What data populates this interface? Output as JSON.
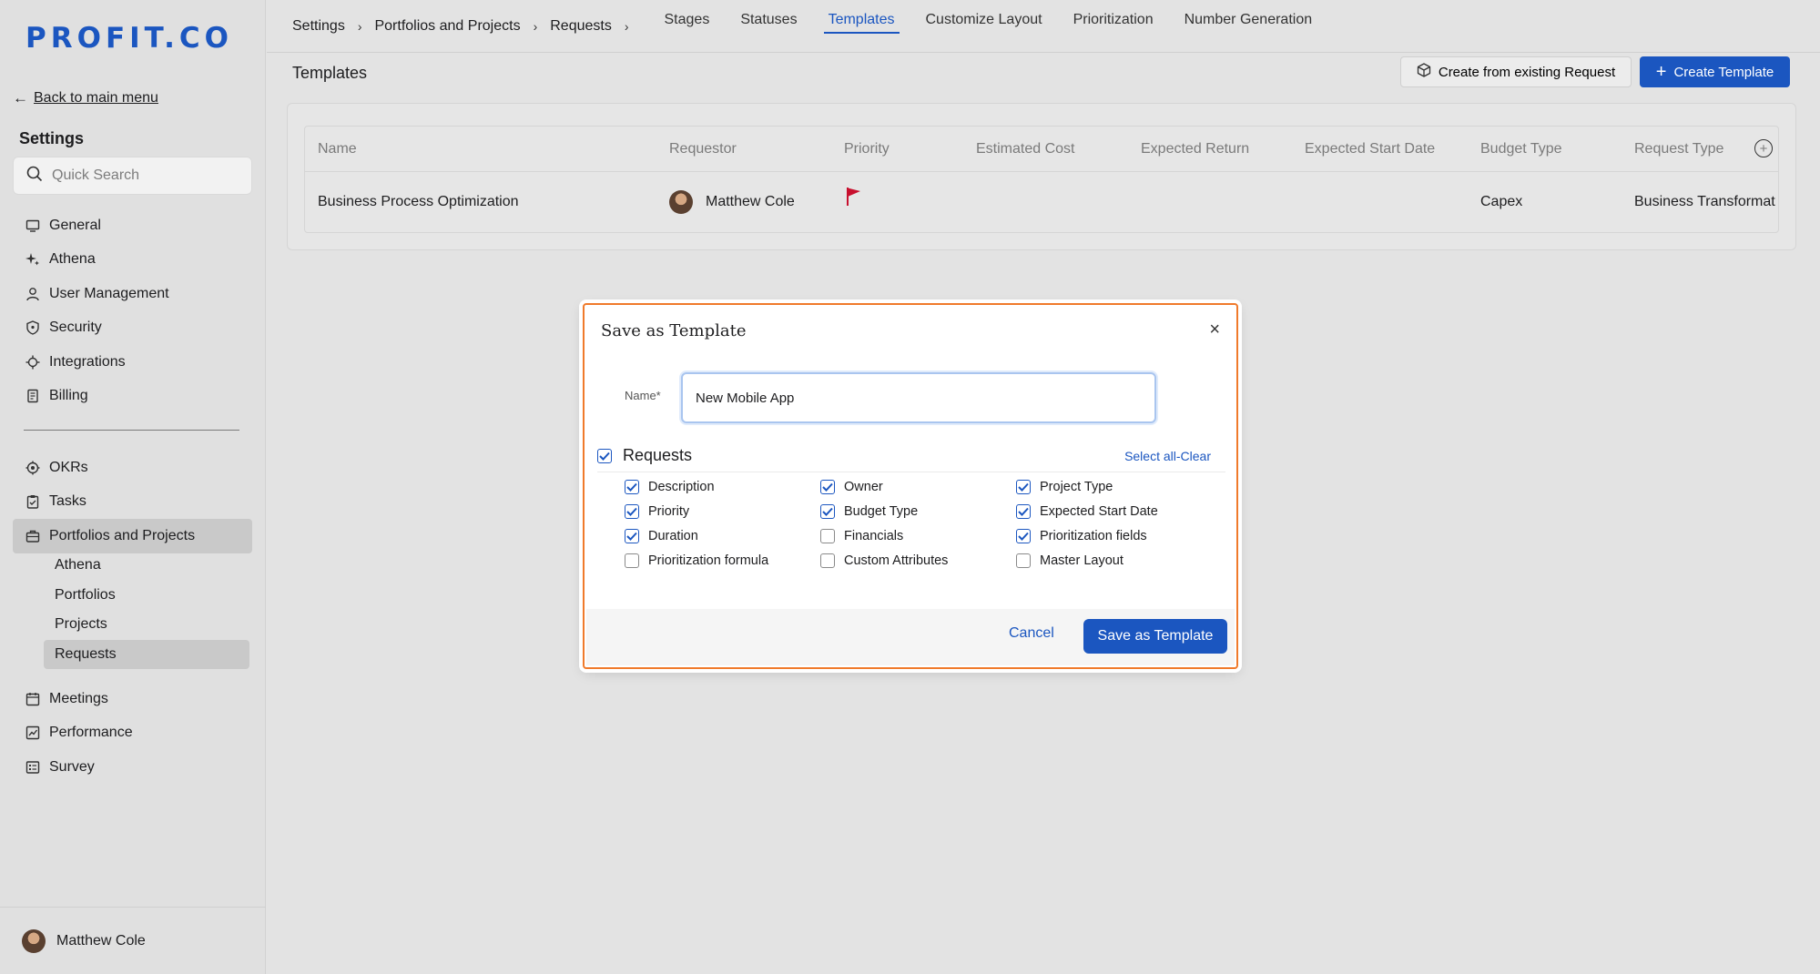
{
  "brand": {
    "logo_text": "PROFIT.CO",
    "accent": "#1b56c0",
    "highlight": "#f07a2b"
  },
  "sidebar": {
    "back_label": "Back to main menu",
    "heading": "Settings",
    "search_placeholder": "Quick Search",
    "group1": [
      {
        "label": "General",
        "icon": "monitor-icon"
      },
      {
        "label": "Athena",
        "icon": "sparkle-icon"
      },
      {
        "label": "User Management",
        "icon": "user-icon"
      },
      {
        "label": "Security",
        "icon": "shield-icon"
      },
      {
        "label": "Integrations",
        "icon": "plug-icon"
      },
      {
        "label": "Billing",
        "icon": "receipt-icon"
      }
    ],
    "group2": [
      {
        "label": "OKRs",
        "icon": "target-icon"
      },
      {
        "label": "Tasks",
        "icon": "clipboard-icon"
      },
      {
        "label": "Portfolios and Projects",
        "icon": "briefcase-icon",
        "active": true
      }
    ],
    "subitems": [
      {
        "label": "Athena"
      },
      {
        "label": "Portfolios"
      },
      {
        "label": "Projects"
      },
      {
        "label": "Requests",
        "active": true
      }
    ],
    "group3": [
      {
        "label": "Meetings",
        "icon": "calendar-icon"
      },
      {
        "label": "Performance",
        "icon": "chart-icon"
      },
      {
        "label": "Survey",
        "icon": "survey-icon"
      }
    ],
    "user_name": "Matthew Cole"
  },
  "topbar": {
    "breadcrumbs": [
      "Settings",
      "Portfolios and Projects",
      "Requests"
    ],
    "tabs": [
      {
        "label": "Stages"
      },
      {
        "label": "Statuses"
      },
      {
        "label": "Templates",
        "active": true
      },
      {
        "label": "Customize Layout"
      },
      {
        "label": "Prioritization"
      },
      {
        "label": "Number Generation"
      }
    ]
  },
  "page": {
    "title": "Templates",
    "create_from_existing_label": "Create from existing Request",
    "create_template_label": "Create Template"
  },
  "table": {
    "columns": [
      "Name",
      "Requestor",
      "Priority",
      "Estimated Cost",
      "Expected Return",
      "Expected Start Date",
      "Budget Type",
      "Request Type"
    ],
    "rows": [
      {
        "name": "Business Process Optimization",
        "requestor": "Matthew Cole",
        "priority_icon": "red-flag-icon",
        "estimated_cost": "",
        "expected_return": "",
        "expected_start_date": "",
        "budget_type": "Capex",
        "request_type": "Business Transformat"
      }
    ]
  },
  "modal": {
    "title": "Save as Template",
    "name_label": "Name*",
    "name_value": "New Mobile App",
    "section_label": "Requests",
    "section_checked": true,
    "select_all_label": "Select all-Clear",
    "options": [
      {
        "label": "Description",
        "checked": true
      },
      {
        "label": "Owner",
        "checked": true
      },
      {
        "label": "Project Type",
        "checked": true
      },
      {
        "label": "Priority",
        "checked": true
      },
      {
        "label": "Budget Type",
        "checked": true
      },
      {
        "label": "Expected Start Date",
        "checked": true
      },
      {
        "label": "Duration",
        "checked": true
      },
      {
        "label": "Financials",
        "checked": false
      },
      {
        "label": "Prioritization fields",
        "checked": true
      },
      {
        "label": "Prioritization formula",
        "checked": false
      },
      {
        "label": "Custom Attributes",
        "checked": false
      },
      {
        "label": "Master Layout",
        "checked": false
      }
    ],
    "cancel_label": "Cancel",
    "save_label": "Save as Template"
  }
}
